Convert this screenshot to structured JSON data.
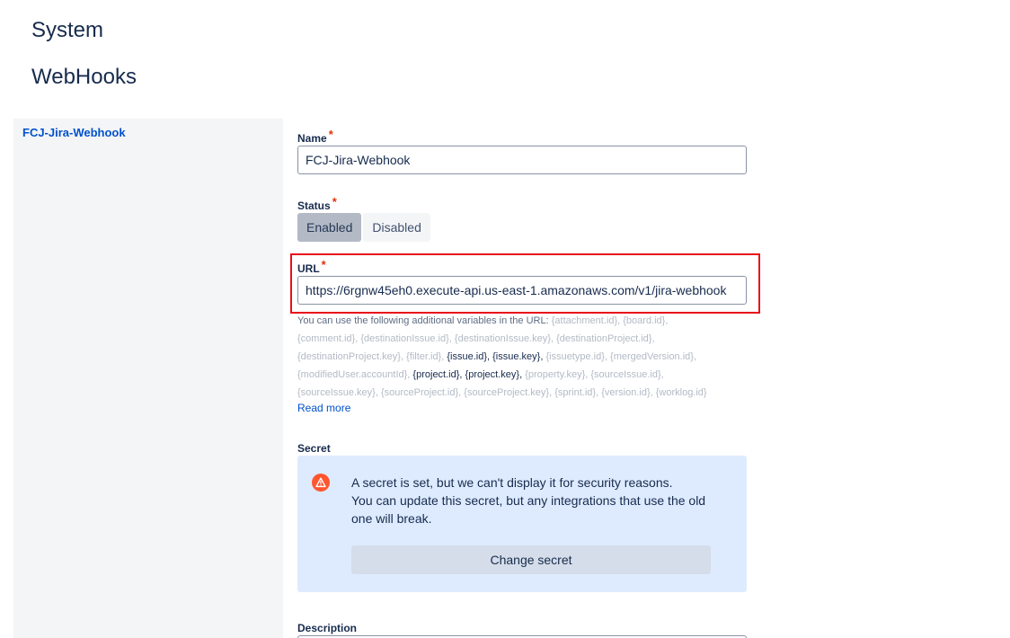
{
  "page": {
    "section": "System",
    "title": "WebHooks"
  },
  "sidebar": {
    "items": [
      {
        "label": "FCJ-Jira-Webhook"
      }
    ]
  },
  "form": {
    "name": {
      "label": "Name",
      "value": "FCJ-Jira-Webhook"
    },
    "status": {
      "label": "Status",
      "options": [
        "Enabled",
        "Disabled"
      ],
      "selected": "Enabled"
    },
    "url": {
      "label": "URL",
      "value": "https://6rgnw45eh0.execute-api.us-east-1.amazonaws.com/v1/jira-webhook"
    },
    "required_mark": "*",
    "url_help": {
      "intro": "You can use the following additional variables in the URL:",
      "variables": [
        {
          "text": "{attachment.id},",
          "dark": false
        },
        {
          "text": "{board.id},",
          "dark": false
        },
        {
          "text": "{comment.id},",
          "dark": false
        },
        {
          "text": "{destinationIssue.id},",
          "dark": false
        },
        {
          "text": "{destinationIssue.key},",
          "dark": false
        },
        {
          "text": "{destinationProject.id},",
          "dark": false
        },
        {
          "text": "{destinationProject.key},",
          "dark": false
        },
        {
          "text": "{filter.id},",
          "dark": false
        },
        {
          "text": "{issue.id},",
          "dark": true
        },
        {
          "text": "{issue.key},",
          "dark": true
        },
        {
          "text": "{issuetype.id},",
          "dark": false
        },
        {
          "text": "{mergedVersion.id},",
          "dark": false
        },
        {
          "text": "{modifiedUser.accountId},",
          "dark": false
        },
        {
          "text": "{project.id},",
          "dark": true
        },
        {
          "text": "{project.key},",
          "dark": true
        },
        {
          "text": "{property.key},",
          "dark": false
        },
        {
          "text": "{sourceIssue.id},",
          "dark": false
        },
        {
          "text": "{sourceIssue.key},",
          "dark": false
        },
        {
          "text": "{sourceProject.id},",
          "dark": false
        },
        {
          "text": "{sourceProject.key},",
          "dark": false
        },
        {
          "text": "{sprint.id},",
          "dark": false
        },
        {
          "text": "{version.id},",
          "dark": false
        },
        {
          "text": "{worklog.id}",
          "dark": false
        }
      ],
      "read_more": "Read more"
    },
    "secret": {
      "label": "Secret",
      "icon": "warning-icon",
      "line1": "A secret is set, but we can't display it for security reasons.",
      "line2": "You can update this secret, but any integrations that use the old one will break.",
      "button": "Change secret"
    },
    "description": {
      "label": "Description"
    }
  },
  "colors": {
    "link": "#0052cc",
    "required": "#de350b",
    "highlight": "#e8101a",
    "warning": "#ff5630",
    "panel": "#deebff"
  }
}
